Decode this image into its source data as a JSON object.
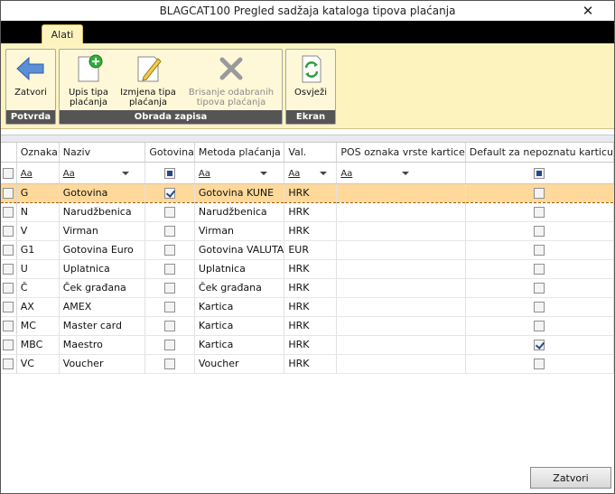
{
  "window": {
    "title": "BLAGCAT100  Pregled sadžaja kataloga tipova plaćanja"
  },
  "ribbon": {
    "tab_label": "Alati",
    "groups": {
      "potvrda": {
        "label": "Potvrda",
        "buttons": {
          "zatvori": "Zatvori"
        }
      },
      "obrada": {
        "label": "Obrada zapisa",
        "buttons": {
          "upis": "Upis tipa plaćanja",
          "izmjena": "Izmjena tipa plaćanja",
          "brisanje": "Brisanje odabranih tipova plaćanja"
        }
      },
      "ekran": {
        "label": "Ekran",
        "buttons": {
          "osvjezi": "Osvježi"
        }
      }
    }
  },
  "grid": {
    "columns": [
      "Oznaka",
      "Naziv",
      "Gotovina",
      "Metoda plaćanja",
      "Val.",
      "POS oznaka vrste kartice",
      "Default za nepoznatu karticu"
    ],
    "filter_placeholder": "Aa",
    "rows": [
      {
        "oznaka": "G",
        "naziv": "Gotovina",
        "gotovina": true,
        "metoda": "Gotovina KUNE",
        "val": "HRK",
        "pos": "",
        "default": false,
        "selected": true
      },
      {
        "oznaka": "N",
        "naziv": "Narudžbenica",
        "gotovina": false,
        "metoda": "Narudžbenica",
        "val": "HRK",
        "pos": "",
        "default": false,
        "selected": false
      },
      {
        "oznaka": "V",
        "naziv": "Virman",
        "gotovina": false,
        "metoda": "Virman",
        "val": "HRK",
        "pos": "",
        "default": false,
        "selected": false
      },
      {
        "oznaka": "G1",
        "naziv": "Gotovina Euro",
        "gotovina": false,
        "metoda": "Gotovina VALUTA",
        "val": "EUR",
        "pos": "",
        "default": false,
        "selected": false
      },
      {
        "oznaka": "U",
        "naziv": "Uplatnica",
        "gotovina": false,
        "metoda": "Uplatnica",
        "val": "HRK",
        "pos": "",
        "default": false,
        "selected": false
      },
      {
        "oznaka": "Č",
        "naziv": "Ček građana",
        "gotovina": false,
        "metoda": "Ček građana",
        "val": "HRK",
        "pos": "",
        "default": false,
        "selected": false
      },
      {
        "oznaka": "AX",
        "naziv": "AMEX",
        "gotovina": false,
        "metoda": "Kartica",
        "val": "HRK",
        "pos": "",
        "default": false,
        "selected": false
      },
      {
        "oznaka": "MC",
        "naziv": "Master card",
        "gotovina": false,
        "metoda": "Kartica",
        "val": "HRK",
        "pos": "",
        "default": false,
        "selected": false
      },
      {
        "oznaka": "MBC",
        "naziv": "Maestro",
        "gotovina": false,
        "metoda": "Kartica",
        "val": "HRK",
        "pos": "",
        "default": true,
        "selected": false
      },
      {
        "oznaka": "VC",
        "naziv": "Voucher",
        "gotovina": false,
        "metoda": "Voucher",
        "val": "HRK",
        "pos": "",
        "default": false,
        "selected": false
      }
    ]
  },
  "footer": {
    "close_label": "Zatvori"
  },
  "colors": {
    "ribbon_bg": "#fdf3bf",
    "selected_row": "#ffd99a",
    "tab_strip": "#000000",
    "group_label_bg": "#555555"
  }
}
